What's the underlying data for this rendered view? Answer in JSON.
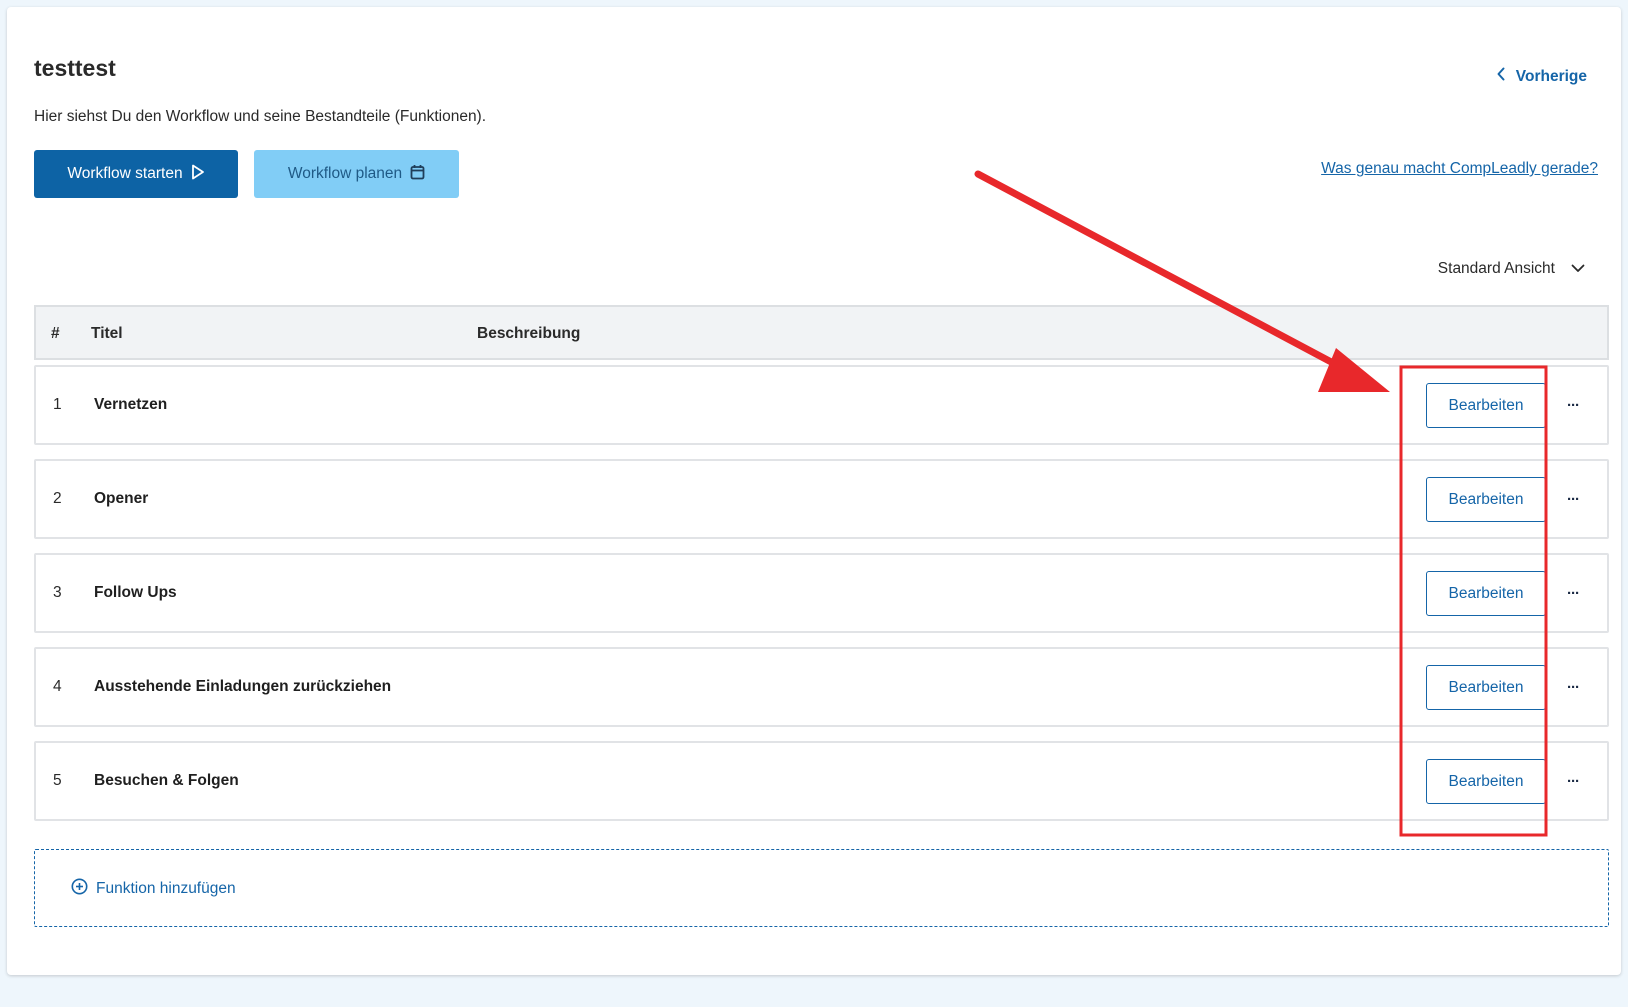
{
  "header": {
    "title": "testtest",
    "subtitle": "Hier siehst Du den Workflow und seine Bestandteile (Funktionen).",
    "prev_label": "Vorherige"
  },
  "actions": {
    "start_label": "Workflow starten",
    "plan_label": "Workflow planen",
    "help_link": "Was genau macht CompLeadly gerade?"
  },
  "view_select": {
    "selected": "Standard Ansicht"
  },
  "table": {
    "columns": [
      "#",
      "Titel",
      "Beschreibung"
    ],
    "rows": [
      {
        "num": "1",
        "title": "Vernetzen",
        "edit_label": "Bearbeiten",
        "more": "···"
      },
      {
        "num": "2",
        "title": "Opener",
        "edit_label": "Bearbeiten",
        "more": "···"
      },
      {
        "num": "3",
        "title": "Follow Ups",
        "edit_label": "Bearbeiten",
        "more": "···"
      },
      {
        "num": "4",
        "title": "Ausstehende Einladungen zurückziehen",
        "edit_label": "Bearbeiten",
        "more": "···"
      },
      {
        "num": "5",
        "title": "Besuchen & Folgen",
        "edit_label": "Bearbeiten",
        "more": "···"
      }
    ],
    "add_label": "Funktion hinzufügen"
  },
  "colors": {
    "primary": "#0d63a5",
    "secondary": "#81cdf6",
    "link": "#1565a8",
    "annotation": "#e8282b"
  },
  "icons": {
    "prev": "chevron-left-icon",
    "start": "play-outline-icon",
    "plan": "calendar-icon",
    "view": "chevron-down-icon",
    "more": "ellipsis-icon",
    "add": "plus-circle-icon"
  }
}
